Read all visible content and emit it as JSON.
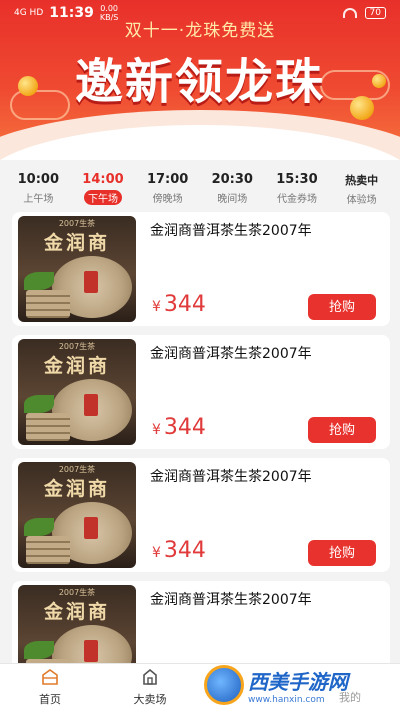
{
  "status_bar": {
    "signal": "4G HD",
    "time": "11:39",
    "net_rate": "0.00",
    "net_unit": "KB/S",
    "battery": "70"
  },
  "banner": {
    "subtitle": "双十一·龙珠免费送",
    "title": "邀新领龙珠"
  },
  "time_tabs": [
    {
      "time": "10:00",
      "label": "上午场"
    },
    {
      "time": "14:00",
      "label": "下午场",
      "active": true
    },
    {
      "time": "17:00",
      "label": "傍晚场"
    },
    {
      "time": "20:30",
      "label": "晚间场"
    },
    {
      "time": "15:30",
      "label": "代金券场"
    },
    {
      "time": "热卖中",
      "label": "体验场"
    }
  ],
  "products": [
    {
      "name": "金润商普洱茶生茶2007年",
      "currency": "¥",
      "price": "344",
      "buy_label": "抢购",
      "image_year": "2007生茶",
      "image_brand": "金润商"
    },
    {
      "name": "金润商普洱茶生茶2007年",
      "currency": "¥",
      "price": "344",
      "buy_label": "抢购",
      "image_year": "2007生茶",
      "image_brand": "金润商"
    },
    {
      "name": "金润商普洱茶生茶2007年",
      "currency": "¥",
      "price": "344",
      "buy_label": "抢购",
      "image_year": "2007生茶",
      "image_brand": "金润商"
    },
    {
      "name": "金润商普洱茶生茶2007年",
      "currency": "¥",
      "price": "",
      "buy_label": "",
      "image_year": "2007生茶",
      "image_brand": "金润商"
    }
  ],
  "bottom_nav": [
    {
      "label": "首页",
      "icon": "home-icon"
    },
    {
      "label": "大卖场",
      "icon": "store-icon"
    },
    {
      "label": "",
      "icon": ""
    },
    {
      "label": "我的",
      "icon": "user-icon"
    }
  ],
  "watermark": {
    "text": "西美手游网",
    "url": "www.hanxin.com"
  },
  "colors": {
    "accent": "#e8302a",
    "price": "#e03a3a"
  }
}
